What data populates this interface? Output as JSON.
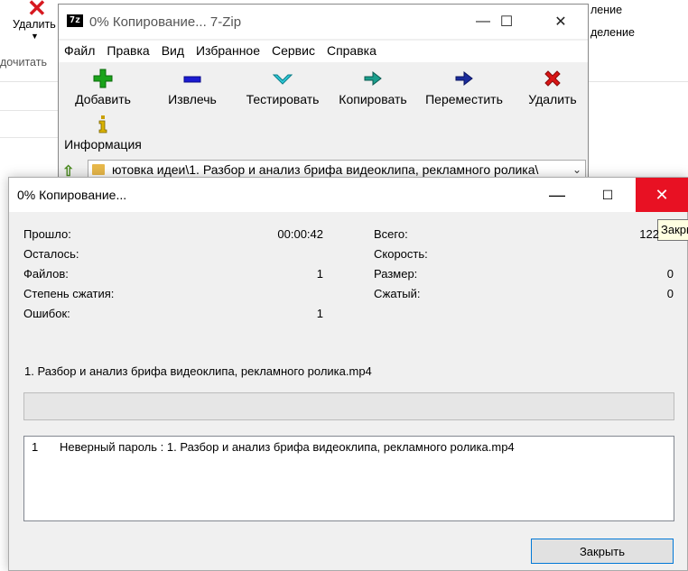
{
  "background": {
    "ribbon_delete_label": "Удалить",
    "ribbon_group_label": "дочитать",
    "ribbon_right_1": "ление",
    "ribbon_right_2": "деление"
  },
  "zip_window": {
    "title": "0% Копирование... 7-Zip",
    "logo": "7z",
    "menu": [
      "Файл",
      "Правка",
      "Вид",
      "Избранное",
      "Сервис",
      "Справка"
    ],
    "toolbar": {
      "add": "Добавить",
      "extract": "Извлечь",
      "test": "Тестировать",
      "copy": "Копировать",
      "move": "Переместить",
      "delete": "Удалить",
      "info": "Информация"
    },
    "address": "ютовка идеи\\1. Разбор и анализ брифа видеоклипа, рекламного ролика\\"
  },
  "dialog": {
    "title": "0% Копирование...",
    "tooltip": "Закрыть",
    "stats_left": [
      {
        "label": "Прошло:",
        "value": "00:00:42"
      },
      {
        "label": "Осталось:",
        "value": ""
      },
      {
        "label": "Файлов:",
        "value": "1"
      },
      {
        "label": "Степень сжатия:",
        "value": ""
      },
      {
        "label": "Ошибок:",
        "value": "1"
      }
    ],
    "stats_right": [
      {
        "label": "Всего:",
        "value": "122"
      },
      {
        "label": "Скорость:",
        "value": ""
      },
      {
        "label": "Размер:",
        "value": "0"
      },
      {
        "label": "Сжатый:",
        "value": "0"
      }
    ],
    "current_file": "1. Разбор и анализ брифа видеоклипа, рекламного ролика.mp4",
    "progress_percent": 0,
    "log": [
      {
        "num": "1",
        "text": "Неверный пароль : 1. Разбор и анализ брифа видеоклипа, рекламного ролика.mp4"
      }
    ],
    "close_button": "Закрыть"
  },
  "colors": {
    "close_red": "#e81123",
    "focus_blue": "#0078d7",
    "progress_green": "#06b025"
  }
}
